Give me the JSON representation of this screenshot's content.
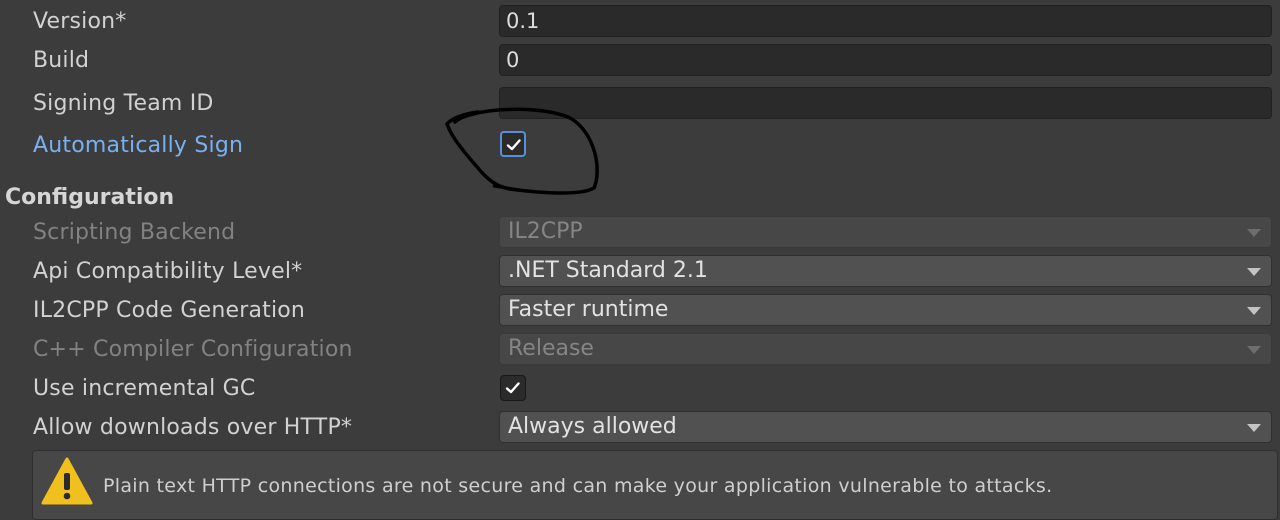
{
  "identification": {
    "version": {
      "label": "Version*",
      "value": "0.1"
    },
    "build": {
      "label": "Build",
      "value": "0"
    },
    "signing_team_id": {
      "label": "Signing Team ID",
      "value": ""
    },
    "automatically_sign": {
      "label": "Automatically Sign",
      "checked": true
    }
  },
  "configuration": {
    "title": "Configuration",
    "scripting_backend": {
      "label": "Scripting Backend",
      "value": "IL2CPP",
      "enabled": false
    },
    "api_compatibility": {
      "label": "Api Compatibility Level*",
      "value": ".NET Standard 2.1"
    },
    "il2cpp_codegen": {
      "label": "IL2CPP Code Generation",
      "value": "Faster runtime"
    },
    "cpp_compiler_config": {
      "label": "C++ Compiler Configuration",
      "value": "Release",
      "enabled": false
    },
    "incremental_gc": {
      "label": "Use incremental GC",
      "checked": true
    },
    "allow_http": {
      "label": "Allow downloads over HTTP*",
      "value": "Always allowed"
    }
  },
  "warning": {
    "icon": "warning-icon",
    "text": "Plain text HTTP connections are not secure and can make your application vulnerable to attacks."
  },
  "colors": {
    "background": "#3c3c3c",
    "link_label": "#7bb0ee",
    "focus_border": "#5a8fd8"
  }
}
